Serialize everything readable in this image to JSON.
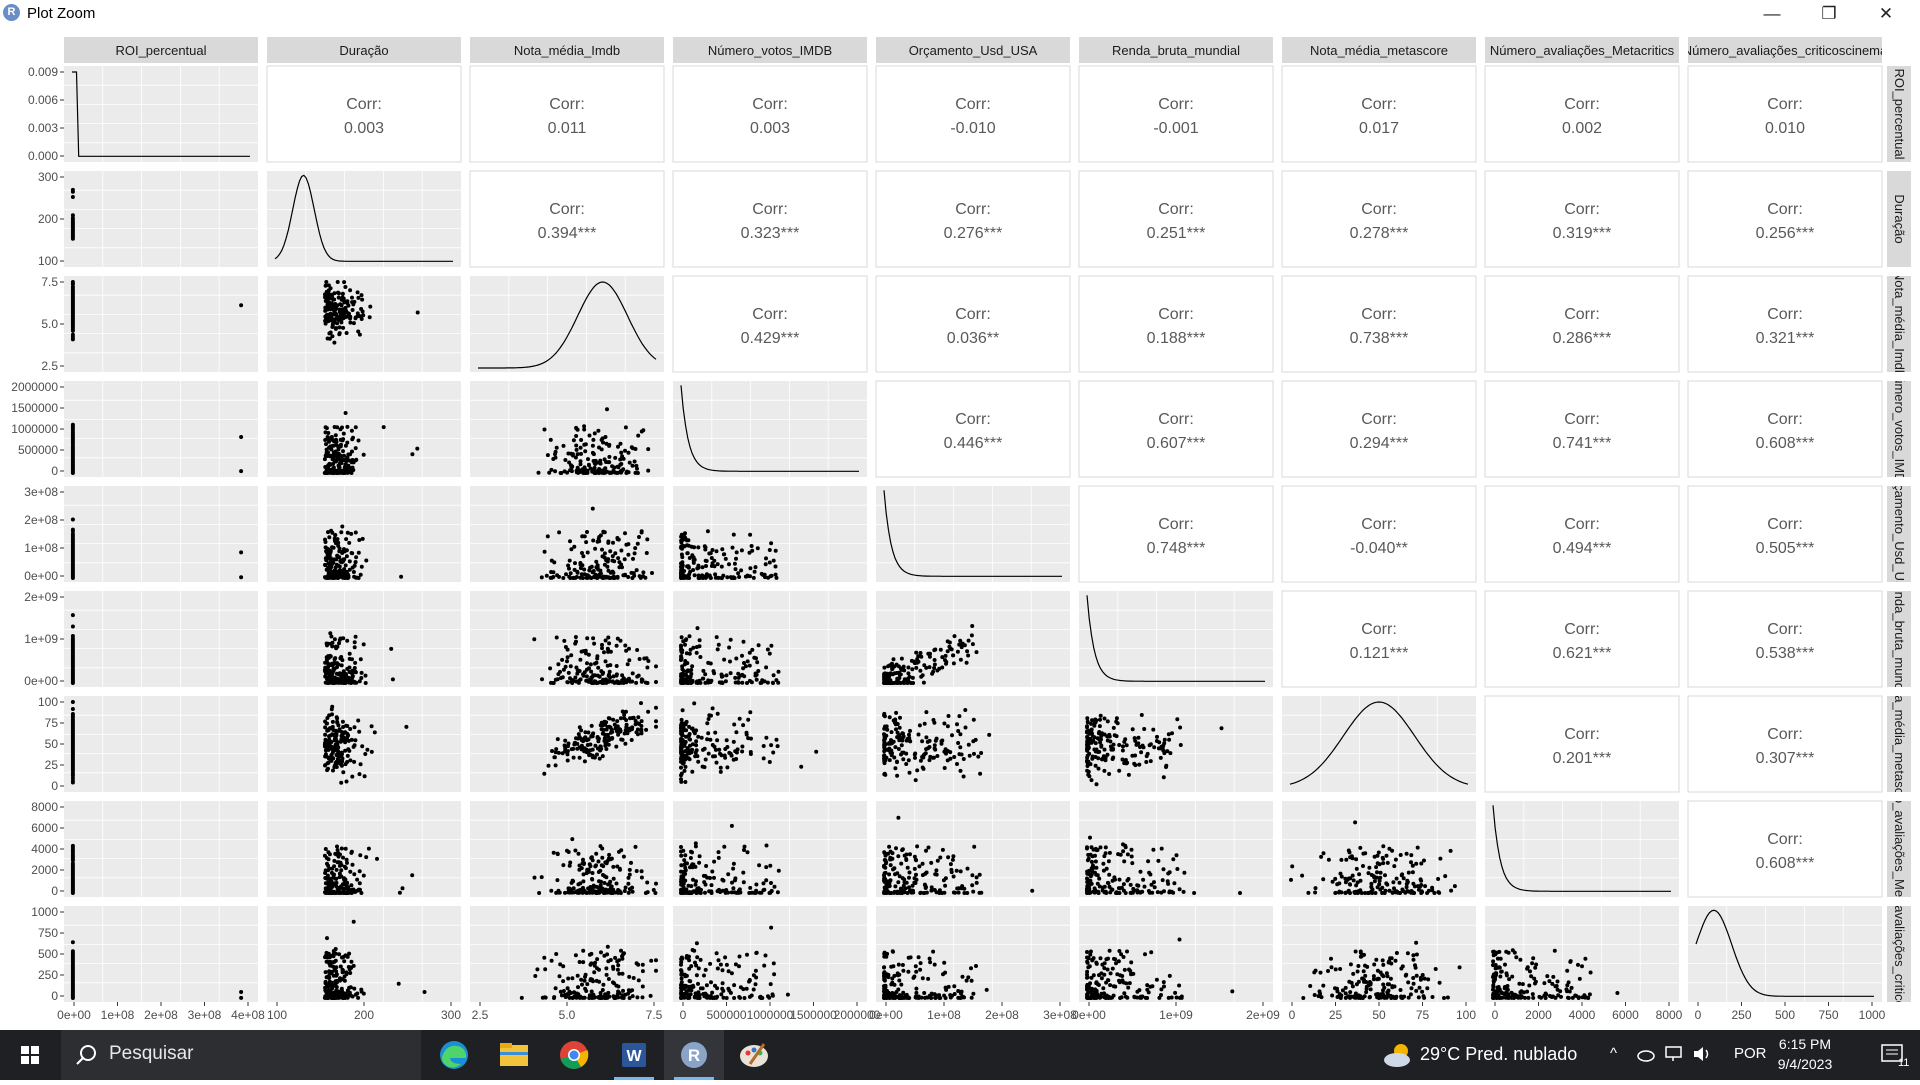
{
  "window": {
    "title": "Plot Zoom",
    "icon": "R",
    "controls": {
      "minimize": "—",
      "maximize": "❐",
      "close": "✕"
    }
  },
  "plot": {
    "variables": [
      "ROI_percentual",
      "Duração",
      "Nota_média_Imdb",
      "Número_votos_IMDB",
      "Orçamento_Usd_USA",
      "Renda_bruta_mundial",
      "Nota_média_metascore",
      "Número_avaliações_Metacritics",
      "Número_avaliações_criticoscinema"
    ],
    "row_strip_labels": [
      "ROI_percentual",
      "Duração",
      "Nota_média_Imdb",
      "Número_votos_IMDB",
      "Orçamento_Usd_USA",
      "Renda_bruta_mundial",
      "Nota_média_metascore",
      "Número_avaliações_Metacritics",
      "Número_avaliações_criticoscinema"
    ],
    "corr_label": "Corr:",
    "correlations": [
      [
        "0.003",
        "0.011",
        "0.003",
        "-0.010",
        "-0.001",
        "0.017",
        "0.002",
        "0.010"
      ],
      [
        "0.394***",
        "0.323***",
        "0.276***",
        "0.251***",
        "0.278***",
        "0.319***",
        "0.256***"
      ],
      [
        "0.429***",
        "0.036**",
        "0.188***",
        "0.738***",
        "0.286***",
        "0.321***"
      ],
      [
        "0.446***",
        "0.607***",
        "0.294***",
        "0.741***",
        "0.608***"
      ],
      [
        "0.748***",
        "-0.040**",
        "0.494***",
        "0.505***"
      ],
      [
        "0.121***",
        "0.621***",
        "0.538***"
      ],
      [
        "0.201***",
        "0.307***"
      ],
      [
        "0.608***"
      ]
    ],
    "x_ticks": [
      [
        "0e+00",
        "1e+08",
        "2e+08",
        "3e+08",
        "4e+08"
      ],
      [
        "100",
        "200",
        "300"
      ],
      [
        "2.5",
        "5.0",
        "7.5"
      ],
      [
        "0",
        "500000",
        "1000000",
        "1500000",
        "2000000"
      ],
      [
        "0e+00",
        "1e+08",
        "2e+08",
        "3e+08"
      ],
      [
        "0e+00",
        "1e+09",
        "2e+09"
      ],
      [
        "0",
        "25",
        "50",
        "75",
        "100"
      ],
      [
        "0",
        "2000",
        "4000",
        "6000",
        "8000"
      ],
      [
        "0",
        "250",
        "500",
        "750",
        "1000"
      ]
    ],
    "y_ticks": [
      [
        "0.009",
        "0.006",
        "0.003",
        "0.000"
      ],
      [
        "300",
        "200",
        "100"
      ],
      [
        "7.5",
        "5.0",
        "2.5"
      ],
      [
        "2000000",
        "1500000",
        "1000000",
        "500000",
        "0"
      ],
      [
        "3e+08",
        "2e+08",
        "1e+08",
        "0e+00"
      ],
      [
        "2e+09",
        "1e+09",
        "0e+00"
      ],
      [
        "100",
        "75",
        "50",
        "25",
        "0"
      ],
      [
        "8000",
        "6000",
        "4000",
        "2000",
        "0"
      ],
      [
        "1000",
        "750",
        "500",
        "250",
        "0"
      ]
    ]
  },
  "taskbar": {
    "search_placeholder": "Pesquisar",
    "apps": [
      "edge-icon",
      "file-explorer-icon",
      "chrome-icon",
      "word-icon",
      "r-icon",
      "paint-icon"
    ],
    "weather": "29°C  Pred. nublado",
    "language": "POR",
    "time": "6:15 PM",
    "date": "9/4/2023",
    "notifications": "11"
  },
  "colors": {
    "panel_bg": "#ebebeb",
    "strip_bg": "#d9d9d9",
    "grid": "#ffffff",
    "points": "#000000",
    "corr_text": "#595959",
    "taskbar_bg": "#1f2023"
  }
}
